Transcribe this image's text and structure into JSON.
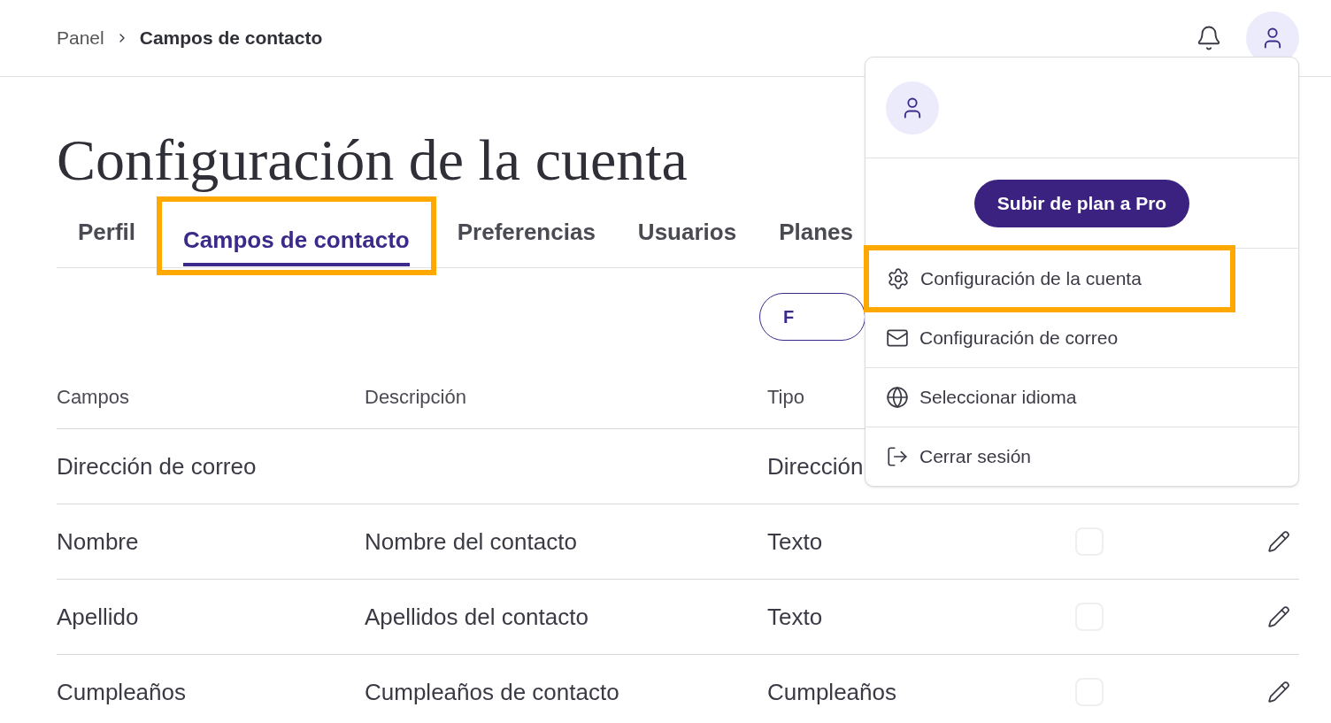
{
  "breadcrumb": {
    "items": [
      "Panel",
      "Campos de contacto"
    ]
  },
  "title": "Configuración de la cuenta",
  "tabs": [
    {
      "label": "Perfil",
      "selected": false,
      "highlighted": false
    },
    {
      "label": "Campos de contacto",
      "selected": true,
      "highlighted": true
    },
    {
      "label": "Preferencias",
      "selected": false,
      "highlighted": false
    },
    {
      "label": "Usuarios",
      "selected": false,
      "highlighted": false
    },
    {
      "label": "Planes",
      "selected": false,
      "highlighted": false
    }
  ],
  "action_button": {
    "label": "F"
  },
  "table": {
    "columns": [
      "Campos",
      "Descripción",
      "Tipo"
    ],
    "rows": [
      {
        "field": "Dirección de correo",
        "type": "Dirección",
        "checked": null
      },
      {
        "field": "Nombre",
        "description": "Nombre del contacto",
        "type": "Texto",
        "checked": false
      },
      {
        "field": "Apellido",
        "description": "Apellidos del contacto",
        "type": "Texto",
        "checked": false
      },
      {
        "field": "Cumpleaños",
        "description": "Cumpleaños de contacto",
        "type": "Cumpleaños",
        "checked": false
      }
    ]
  },
  "user_menu": {
    "upgrade_button": "Subir de plan a Pro",
    "items": [
      {
        "kind": "settings",
        "label": "Configuración de la cuenta",
        "highlighted": true
      },
      {
        "kind": "mail",
        "label": "Configuración de correo",
        "highlighted": false
      },
      {
        "kind": "language",
        "label": "Seleccionar idioma",
        "highlighted": false
      },
      {
        "kind": "logout",
        "label": "Cerrar sesión",
        "highlighted": false
      }
    ]
  }
}
